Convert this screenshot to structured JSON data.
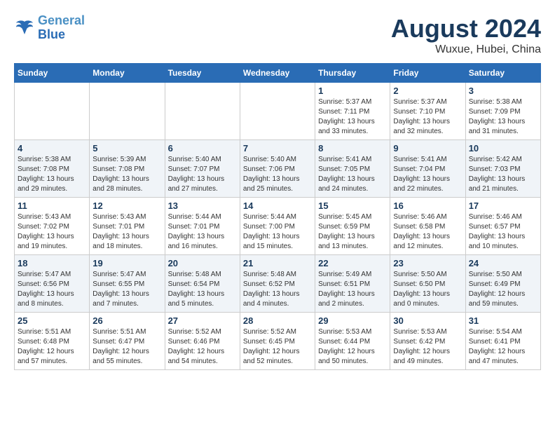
{
  "header": {
    "logo_line1": "General",
    "logo_line2": "Blue",
    "month_year": "August 2024",
    "location": "Wuxue, Hubei, China"
  },
  "days_of_week": [
    "Sunday",
    "Monday",
    "Tuesday",
    "Wednesday",
    "Thursday",
    "Friday",
    "Saturday"
  ],
  "weeks": [
    [
      {
        "day": "",
        "info": ""
      },
      {
        "day": "",
        "info": ""
      },
      {
        "day": "",
        "info": ""
      },
      {
        "day": "",
        "info": ""
      },
      {
        "day": "1",
        "info": "Sunrise: 5:37 AM\nSunset: 7:11 PM\nDaylight: 13 hours\nand 33 minutes."
      },
      {
        "day": "2",
        "info": "Sunrise: 5:37 AM\nSunset: 7:10 PM\nDaylight: 13 hours\nand 32 minutes."
      },
      {
        "day": "3",
        "info": "Sunrise: 5:38 AM\nSunset: 7:09 PM\nDaylight: 13 hours\nand 31 minutes."
      }
    ],
    [
      {
        "day": "4",
        "info": "Sunrise: 5:38 AM\nSunset: 7:08 PM\nDaylight: 13 hours\nand 29 minutes."
      },
      {
        "day": "5",
        "info": "Sunrise: 5:39 AM\nSunset: 7:08 PM\nDaylight: 13 hours\nand 28 minutes."
      },
      {
        "day": "6",
        "info": "Sunrise: 5:40 AM\nSunset: 7:07 PM\nDaylight: 13 hours\nand 27 minutes."
      },
      {
        "day": "7",
        "info": "Sunrise: 5:40 AM\nSunset: 7:06 PM\nDaylight: 13 hours\nand 25 minutes."
      },
      {
        "day": "8",
        "info": "Sunrise: 5:41 AM\nSunset: 7:05 PM\nDaylight: 13 hours\nand 24 minutes."
      },
      {
        "day": "9",
        "info": "Sunrise: 5:41 AM\nSunset: 7:04 PM\nDaylight: 13 hours\nand 22 minutes."
      },
      {
        "day": "10",
        "info": "Sunrise: 5:42 AM\nSunset: 7:03 PM\nDaylight: 13 hours\nand 21 minutes."
      }
    ],
    [
      {
        "day": "11",
        "info": "Sunrise: 5:43 AM\nSunset: 7:02 PM\nDaylight: 13 hours\nand 19 minutes."
      },
      {
        "day": "12",
        "info": "Sunrise: 5:43 AM\nSunset: 7:01 PM\nDaylight: 13 hours\nand 18 minutes."
      },
      {
        "day": "13",
        "info": "Sunrise: 5:44 AM\nSunset: 7:01 PM\nDaylight: 13 hours\nand 16 minutes."
      },
      {
        "day": "14",
        "info": "Sunrise: 5:44 AM\nSunset: 7:00 PM\nDaylight: 13 hours\nand 15 minutes."
      },
      {
        "day": "15",
        "info": "Sunrise: 5:45 AM\nSunset: 6:59 PM\nDaylight: 13 hours\nand 13 minutes."
      },
      {
        "day": "16",
        "info": "Sunrise: 5:46 AM\nSunset: 6:58 PM\nDaylight: 13 hours\nand 12 minutes."
      },
      {
        "day": "17",
        "info": "Sunrise: 5:46 AM\nSunset: 6:57 PM\nDaylight: 13 hours\nand 10 minutes."
      }
    ],
    [
      {
        "day": "18",
        "info": "Sunrise: 5:47 AM\nSunset: 6:56 PM\nDaylight: 13 hours\nand 8 minutes."
      },
      {
        "day": "19",
        "info": "Sunrise: 5:47 AM\nSunset: 6:55 PM\nDaylight: 13 hours\nand 7 minutes."
      },
      {
        "day": "20",
        "info": "Sunrise: 5:48 AM\nSunset: 6:54 PM\nDaylight: 13 hours\nand 5 minutes."
      },
      {
        "day": "21",
        "info": "Sunrise: 5:48 AM\nSunset: 6:52 PM\nDaylight: 13 hours\nand 4 minutes."
      },
      {
        "day": "22",
        "info": "Sunrise: 5:49 AM\nSunset: 6:51 PM\nDaylight: 13 hours\nand 2 minutes."
      },
      {
        "day": "23",
        "info": "Sunrise: 5:50 AM\nSunset: 6:50 PM\nDaylight: 13 hours\nand 0 minutes."
      },
      {
        "day": "24",
        "info": "Sunrise: 5:50 AM\nSunset: 6:49 PM\nDaylight: 12 hours\nand 59 minutes."
      }
    ],
    [
      {
        "day": "25",
        "info": "Sunrise: 5:51 AM\nSunset: 6:48 PM\nDaylight: 12 hours\nand 57 minutes."
      },
      {
        "day": "26",
        "info": "Sunrise: 5:51 AM\nSunset: 6:47 PM\nDaylight: 12 hours\nand 55 minutes."
      },
      {
        "day": "27",
        "info": "Sunrise: 5:52 AM\nSunset: 6:46 PM\nDaylight: 12 hours\nand 54 minutes."
      },
      {
        "day": "28",
        "info": "Sunrise: 5:52 AM\nSunset: 6:45 PM\nDaylight: 12 hours\nand 52 minutes."
      },
      {
        "day": "29",
        "info": "Sunrise: 5:53 AM\nSunset: 6:44 PM\nDaylight: 12 hours\nand 50 minutes."
      },
      {
        "day": "30",
        "info": "Sunrise: 5:53 AM\nSunset: 6:42 PM\nDaylight: 12 hours\nand 49 minutes."
      },
      {
        "day": "31",
        "info": "Sunrise: 5:54 AM\nSunset: 6:41 PM\nDaylight: 12 hours\nand 47 minutes."
      }
    ]
  ]
}
